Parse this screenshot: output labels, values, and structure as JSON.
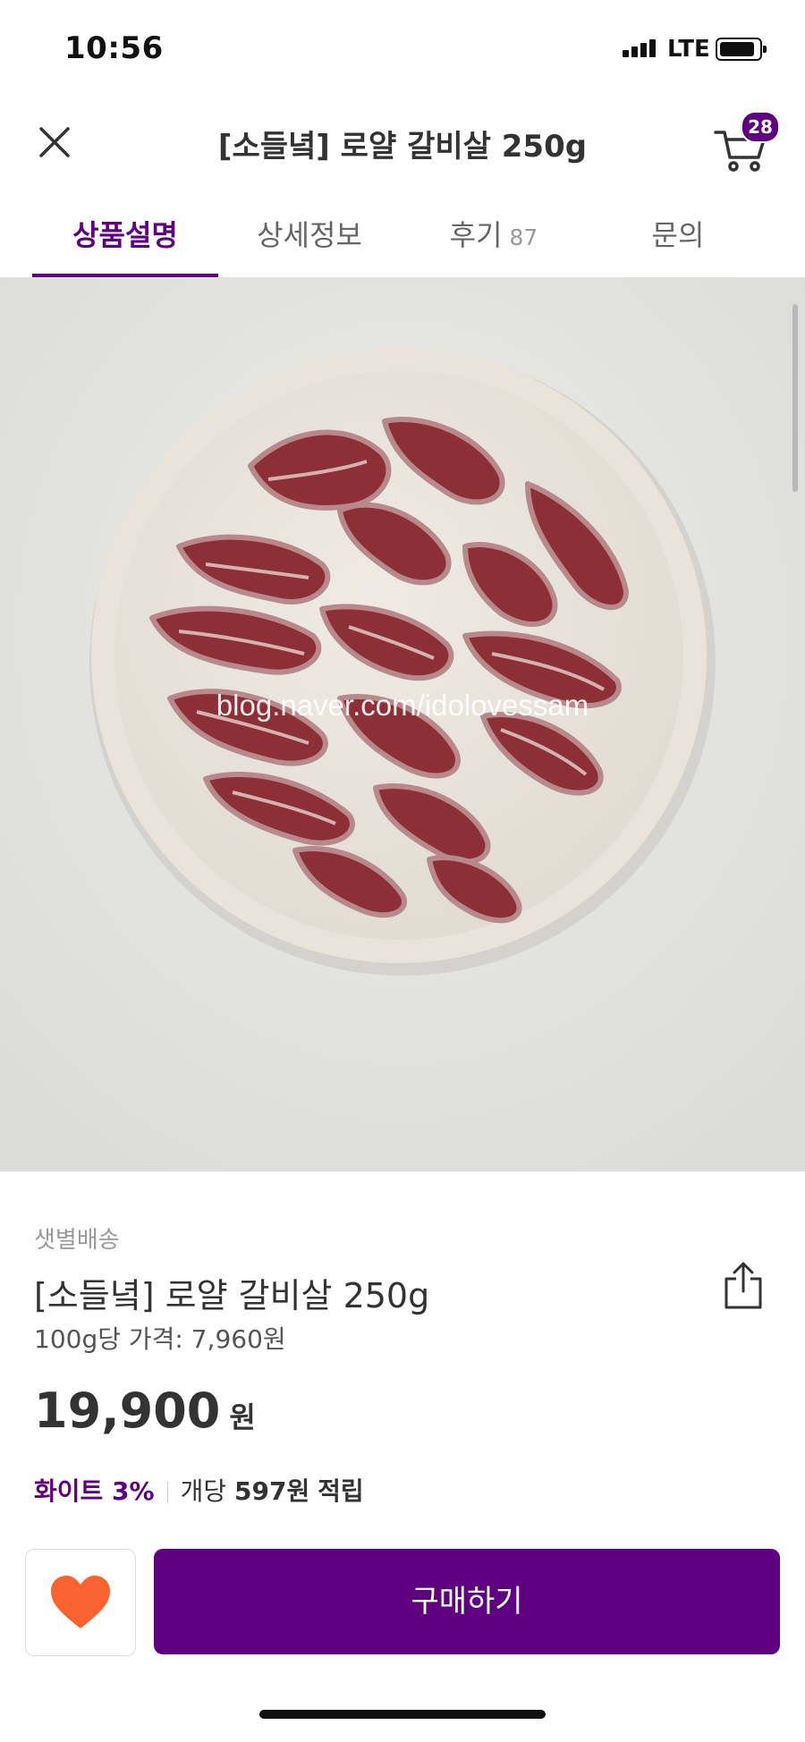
{
  "status_bar": {
    "time": "10:56",
    "network": "LTE"
  },
  "header": {
    "title": "[소들녘] 로얄 갈비살 250g",
    "cart_count": "28"
  },
  "tabs": [
    {
      "label": "상품설명",
      "active": true
    },
    {
      "label": "상세정보",
      "active": false
    },
    {
      "label": "후기",
      "count": "87",
      "active": false
    },
    {
      "label": "문의",
      "active": false
    }
  ],
  "image": {
    "watermark": "blog.naver.com/idolovessam"
  },
  "product": {
    "delivery": "샛별배송",
    "name": "[소들녘] 로얄 갈비살 250g",
    "unit_price": "100g당 가격: 7,960원",
    "price": "19,900",
    "currency": "원",
    "points": {
      "grade": "화이트 3%",
      "prefix": "개당",
      "amount": "597원",
      "suffix": "적립"
    }
  },
  "actions": {
    "buy_label": "구매하기"
  },
  "colors": {
    "brand": "#5f0080",
    "heart": "#fa622f"
  }
}
